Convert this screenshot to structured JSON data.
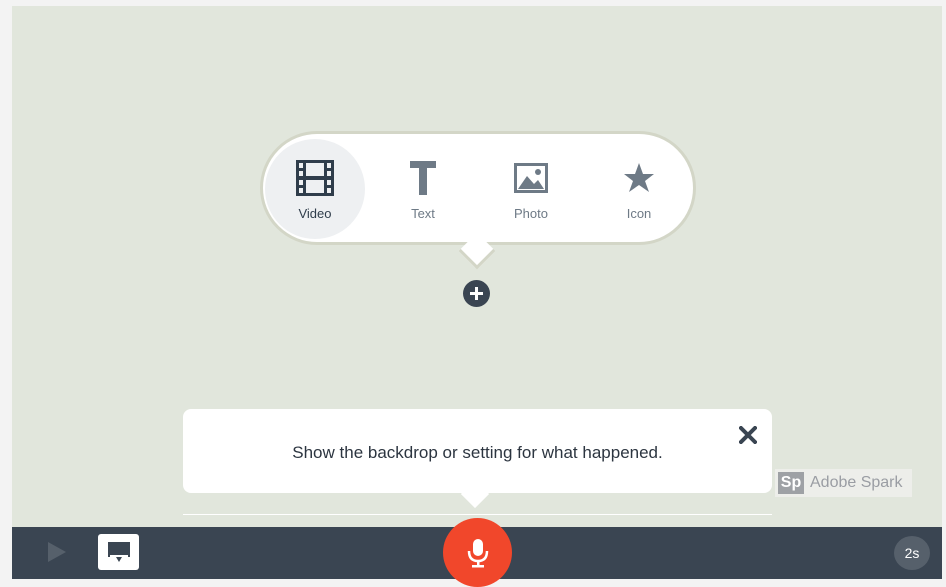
{
  "add_menu": {
    "options": [
      {
        "label": "Video",
        "icon": "film-icon",
        "selected": true
      },
      {
        "label": "Text",
        "icon": "text-icon",
        "selected": false
      },
      {
        "label": "Photo",
        "icon": "image-icon",
        "selected": false
      },
      {
        "label": "Icon",
        "icon": "star-icon",
        "selected": false
      }
    ],
    "add_icon": "plus-icon"
  },
  "hint": {
    "text": "Show the backdrop or setting for what happened.",
    "close_icon": "close-icon"
  },
  "branding": {
    "mark": "Sp",
    "name": "Adobe Spark"
  },
  "toolbar": {
    "play_icon": "play-icon",
    "caption_icon": "caption-icon",
    "mic_icon": "microphone-icon",
    "duration": "2s"
  },
  "colors": {
    "stage_bg": "#e1e6dc",
    "toolbar_bg": "#3a4552",
    "record_accent": "#f1472b",
    "icon_selected": "#2f3d4b",
    "icon_default": "#6e7a86"
  }
}
